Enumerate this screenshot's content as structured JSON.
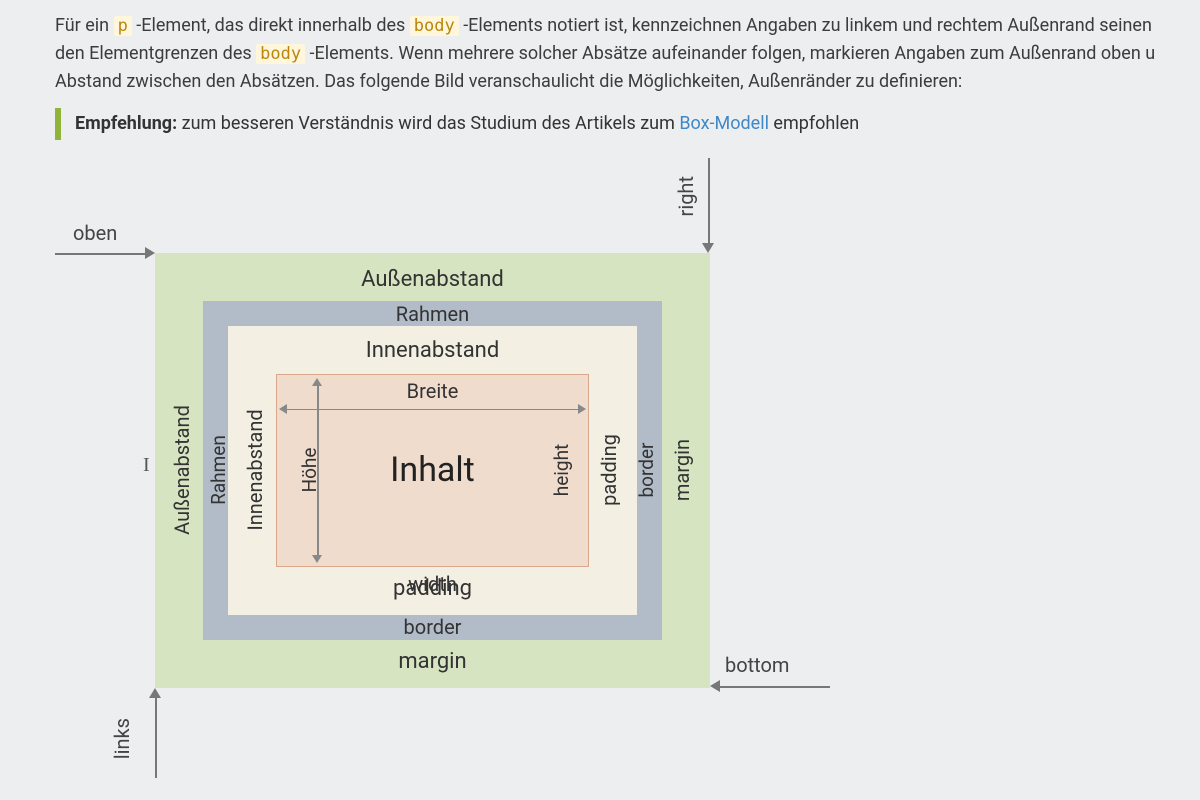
{
  "para": {
    "t1": "Für ein ",
    "code1": "p",
    "t2": " -Element, das direkt innerhalb des ",
    "code2": "body",
    "t3": " -Elements notiert ist, kennzeichnen Angaben zu linkem und rechtem Außenrand seinen",
    "t4": "den Elementgrenzen des ",
    "code3": "body",
    "t5": " -Elements. Wenn mehrere solcher Absätze aufeinander folgen, markieren Angaben zum Außenrand oben u",
    "t6": "Abstand zwischen den Absätzen. Das folgende Bild veranschaulicht die Möglichkeiten, Außenränder zu definieren:"
  },
  "callout": {
    "label": "Empfehlung:",
    "t1": " zum besseren Verständnis wird das Studium des Artikels zum ",
    "link": "Box-Modell",
    "t2": " empfohlen"
  },
  "diagram": {
    "arrows": {
      "top": "oben",
      "right": "right",
      "bottom": "bottom",
      "left": "links"
    },
    "labels": {
      "margin_de_top": "Außenabstand",
      "border_de_top": "Rahmen",
      "padding_de_top": "Innenabstand",
      "width_de": "Breite",
      "content": "Inhalt",
      "height_de": "Höhe",
      "height_en": "height",
      "width_en": "width",
      "padding_en_side": "padding",
      "border_en_side": "border",
      "margin_en_side": "margin",
      "padding_de_side": "Innenabstand",
      "border_de_side": "Rahmen",
      "margin_de_side": "Außenabstand",
      "padding_en_bot": "padding",
      "border_en_bot": "border",
      "margin_en_bot": "margin"
    }
  }
}
